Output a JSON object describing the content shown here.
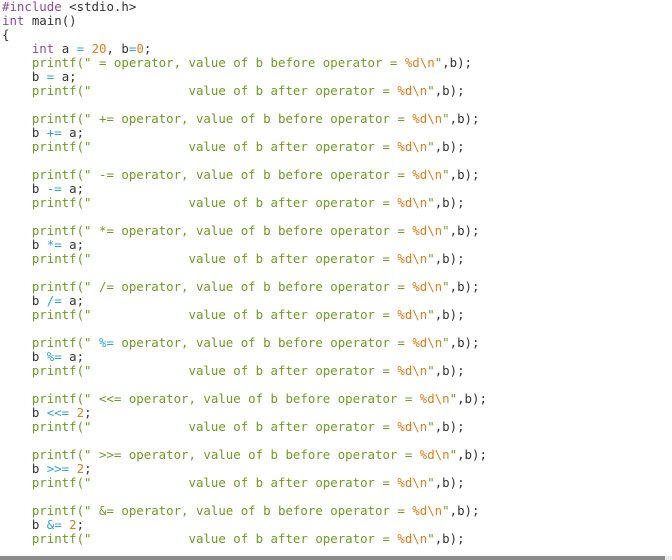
{
  "colors": {
    "text": "#333333",
    "preprocessor": "#8e4898",
    "keyword": "#8e4898",
    "string": "#6f9a23",
    "format_spec": "#df7c1a",
    "number": "#df7c1a",
    "operator": "#2ba7c8",
    "background": "#ffffff"
  },
  "hscrollbar": {
    "thumb_fraction": 0.99
  },
  "code": {
    "lines": [
      [
        {
          "t": "#include",
          "c": "preprocessor"
        },
        {
          "t": " <stdio.h>",
          "c": "text"
        }
      ],
      [
        {
          "t": "int",
          "c": "keyword"
        },
        {
          "t": " main()",
          "c": "text"
        }
      ],
      [
        {
          "t": "{",
          "c": "text"
        }
      ],
      [
        {
          "t": "    ",
          "c": "text"
        },
        {
          "t": "int",
          "c": "keyword"
        },
        {
          "t": " a ",
          "c": "text"
        },
        {
          "t": "=",
          "c": "operator"
        },
        {
          "t": " ",
          "c": "text"
        },
        {
          "t": "20",
          "c": "number"
        },
        {
          "t": ", b",
          "c": "text"
        },
        {
          "t": "=",
          "c": "operator"
        },
        {
          "t": "0",
          "c": "number"
        },
        {
          "t": ";",
          "c": "text"
        }
      ],
      [
        {
          "t": "    ",
          "c": "text"
        },
        {
          "t": "printf(\" = operator, value of b before operator = ",
          "c": "string"
        },
        {
          "t": "%d\\n",
          "c": "format_spec"
        },
        {
          "t": "\"",
          "c": "string"
        },
        {
          "t": ",b);",
          "c": "text"
        }
      ],
      [
        {
          "t": "    b ",
          "c": "text"
        },
        {
          "t": "=",
          "c": "operator"
        },
        {
          "t": " a;",
          "c": "text"
        }
      ],
      [
        {
          "t": "    ",
          "c": "text"
        },
        {
          "t": "printf(\"             value of b after operator = ",
          "c": "string"
        },
        {
          "t": "%d\\n",
          "c": "format_spec"
        },
        {
          "t": "\"",
          "c": "string"
        },
        {
          "t": ",b);",
          "c": "text"
        }
      ],
      [],
      [
        {
          "t": "    ",
          "c": "text"
        },
        {
          "t": "printf(\" += operator, value of b before operator = ",
          "c": "string"
        },
        {
          "t": "%d\\n",
          "c": "format_spec"
        },
        {
          "t": "\"",
          "c": "string"
        },
        {
          "t": ",b);",
          "c": "text"
        }
      ],
      [
        {
          "t": "    b ",
          "c": "text"
        },
        {
          "t": "+=",
          "c": "operator"
        },
        {
          "t": " a;",
          "c": "text"
        }
      ],
      [
        {
          "t": "    ",
          "c": "text"
        },
        {
          "t": "printf(\"             value of b after operator = ",
          "c": "string"
        },
        {
          "t": "%d\\n",
          "c": "format_spec"
        },
        {
          "t": "\"",
          "c": "string"
        },
        {
          "t": ",b);",
          "c": "text"
        }
      ],
      [],
      [
        {
          "t": "    ",
          "c": "text"
        },
        {
          "t": "printf(\" -= operator, value of b before operator = ",
          "c": "string"
        },
        {
          "t": "%d\\n",
          "c": "format_spec"
        },
        {
          "t": "\"",
          "c": "string"
        },
        {
          "t": ",b);",
          "c": "text"
        }
      ],
      [
        {
          "t": "    b ",
          "c": "text"
        },
        {
          "t": "-=",
          "c": "operator"
        },
        {
          "t": " a;",
          "c": "text"
        }
      ],
      [
        {
          "t": "    ",
          "c": "text"
        },
        {
          "t": "printf(\"             value of b after operator = ",
          "c": "string"
        },
        {
          "t": "%d\\n",
          "c": "format_spec"
        },
        {
          "t": "\"",
          "c": "string"
        },
        {
          "t": ",b);",
          "c": "text"
        }
      ],
      [],
      [
        {
          "t": "    ",
          "c": "text"
        },
        {
          "t": "printf(\" *= operator, value of b before operator = ",
          "c": "string"
        },
        {
          "t": "%d\\n",
          "c": "format_spec"
        },
        {
          "t": "\"",
          "c": "string"
        },
        {
          "t": ",b);",
          "c": "text"
        }
      ],
      [
        {
          "t": "    b ",
          "c": "text"
        },
        {
          "t": "*=",
          "c": "operator"
        },
        {
          "t": " a;",
          "c": "text"
        }
      ],
      [
        {
          "t": "    ",
          "c": "text"
        },
        {
          "t": "printf(\"             value of b after operator = ",
          "c": "string"
        },
        {
          "t": "%d\\n",
          "c": "format_spec"
        },
        {
          "t": "\"",
          "c": "string"
        },
        {
          "t": ",b);",
          "c": "text"
        }
      ],
      [],
      [
        {
          "t": "    ",
          "c": "text"
        },
        {
          "t": "printf(\" /= operator, value of b before operator = ",
          "c": "string"
        },
        {
          "t": "%d\\n",
          "c": "format_spec"
        },
        {
          "t": "\"",
          "c": "string"
        },
        {
          "t": ",b);",
          "c": "text"
        }
      ],
      [
        {
          "t": "    b ",
          "c": "text"
        },
        {
          "t": "/=",
          "c": "operator"
        },
        {
          "t": " a;",
          "c": "text"
        }
      ],
      [
        {
          "t": "    ",
          "c": "text"
        },
        {
          "t": "printf(\"             value of b after operator = ",
          "c": "string"
        },
        {
          "t": "%d\\n",
          "c": "format_spec"
        },
        {
          "t": "\"",
          "c": "string"
        },
        {
          "t": ",b);",
          "c": "text"
        }
      ],
      [],
      [
        {
          "t": "    ",
          "c": "text"
        },
        {
          "t": "printf(\" ",
          "c": "string"
        },
        {
          "t": "%=",
          "c": "operator"
        },
        {
          "t": " operator, value of b before operator = ",
          "c": "string"
        },
        {
          "t": "%d\\n",
          "c": "format_spec"
        },
        {
          "t": "\"",
          "c": "string"
        },
        {
          "t": ",b);",
          "c": "text"
        }
      ],
      [
        {
          "t": "    b ",
          "c": "text"
        },
        {
          "t": "%=",
          "c": "operator"
        },
        {
          "t": " a;",
          "c": "text"
        }
      ],
      [
        {
          "t": "    ",
          "c": "text"
        },
        {
          "t": "printf(\"             value of b after operator = ",
          "c": "string"
        },
        {
          "t": "%d\\n",
          "c": "format_spec"
        },
        {
          "t": "\"",
          "c": "string"
        },
        {
          "t": ",b);",
          "c": "text"
        }
      ],
      [],
      [
        {
          "t": "    ",
          "c": "text"
        },
        {
          "t": "printf(\" <<= operator, value of b before operator = ",
          "c": "string"
        },
        {
          "t": "%d\\n",
          "c": "format_spec"
        },
        {
          "t": "\"",
          "c": "string"
        },
        {
          "t": ",b);",
          "c": "text"
        }
      ],
      [
        {
          "t": "    b ",
          "c": "text"
        },
        {
          "t": "<<=",
          "c": "operator"
        },
        {
          "t": " ",
          "c": "text"
        },
        {
          "t": "2",
          "c": "number"
        },
        {
          "t": ";",
          "c": "text"
        }
      ],
      [
        {
          "t": "    ",
          "c": "text"
        },
        {
          "t": "printf(\"             value of b after operator = ",
          "c": "string"
        },
        {
          "t": "%d\\n",
          "c": "format_spec"
        },
        {
          "t": "\"",
          "c": "string"
        },
        {
          "t": ",b);",
          "c": "text"
        }
      ],
      [],
      [
        {
          "t": "    ",
          "c": "text"
        },
        {
          "t": "printf(\" >>= operator, value of b before operator = ",
          "c": "string"
        },
        {
          "t": "%d\\n",
          "c": "format_spec"
        },
        {
          "t": "\"",
          "c": "string"
        },
        {
          "t": ",b);",
          "c": "text"
        }
      ],
      [
        {
          "t": "    b ",
          "c": "text"
        },
        {
          "t": ">>=",
          "c": "operator"
        },
        {
          "t": " ",
          "c": "text"
        },
        {
          "t": "2",
          "c": "number"
        },
        {
          "t": ";",
          "c": "text"
        }
      ],
      [
        {
          "t": "    ",
          "c": "text"
        },
        {
          "t": "printf(\"             value of b after operator = ",
          "c": "string"
        },
        {
          "t": "%d\\n",
          "c": "format_spec"
        },
        {
          "t": "\"",
          "c": "string"
        },
        {
          "t": ",b);",
          "c": "text"
        }
      ],
      [],
      [
        {
          "t": "    ",
          "c": "text"
        },
        {
          "t": "printf(\" &= operator, value of b before operator = ",
          "c": "string"
        },
        {
          "t": "%d\\n",
          "c": "format_spec"
        },
        {
          "t": "\"",
          "c": "string"
        },
        {
          "t": ",b);",
          "c": "text"
        }
      ],
      [
        {
          "t": "    b ",
          "c": "text"
        },
        {
          "t": "&=",
          "c": "operator"
        },
        {
          "t": " ",
          "c": "text"
        },
        {
          "t": "2",
          "c": "number"
        },
        {
          "t": ";",
          "c": "text"
        }
      ],
      [
        {
          "t": "    ",
          "c": "text"
        },
        {
          "t": "printf(\"             value of b after operator = ",
          "c": "string"
        },
        {
          "t": "%d\\n",
          "c": "format_spec"
        },
        {
          "t": "\"",
          "c": "string"
        },
        {
          "t": ",b);",
          "c": "text"
        }
      ]
    ]
  }
}
